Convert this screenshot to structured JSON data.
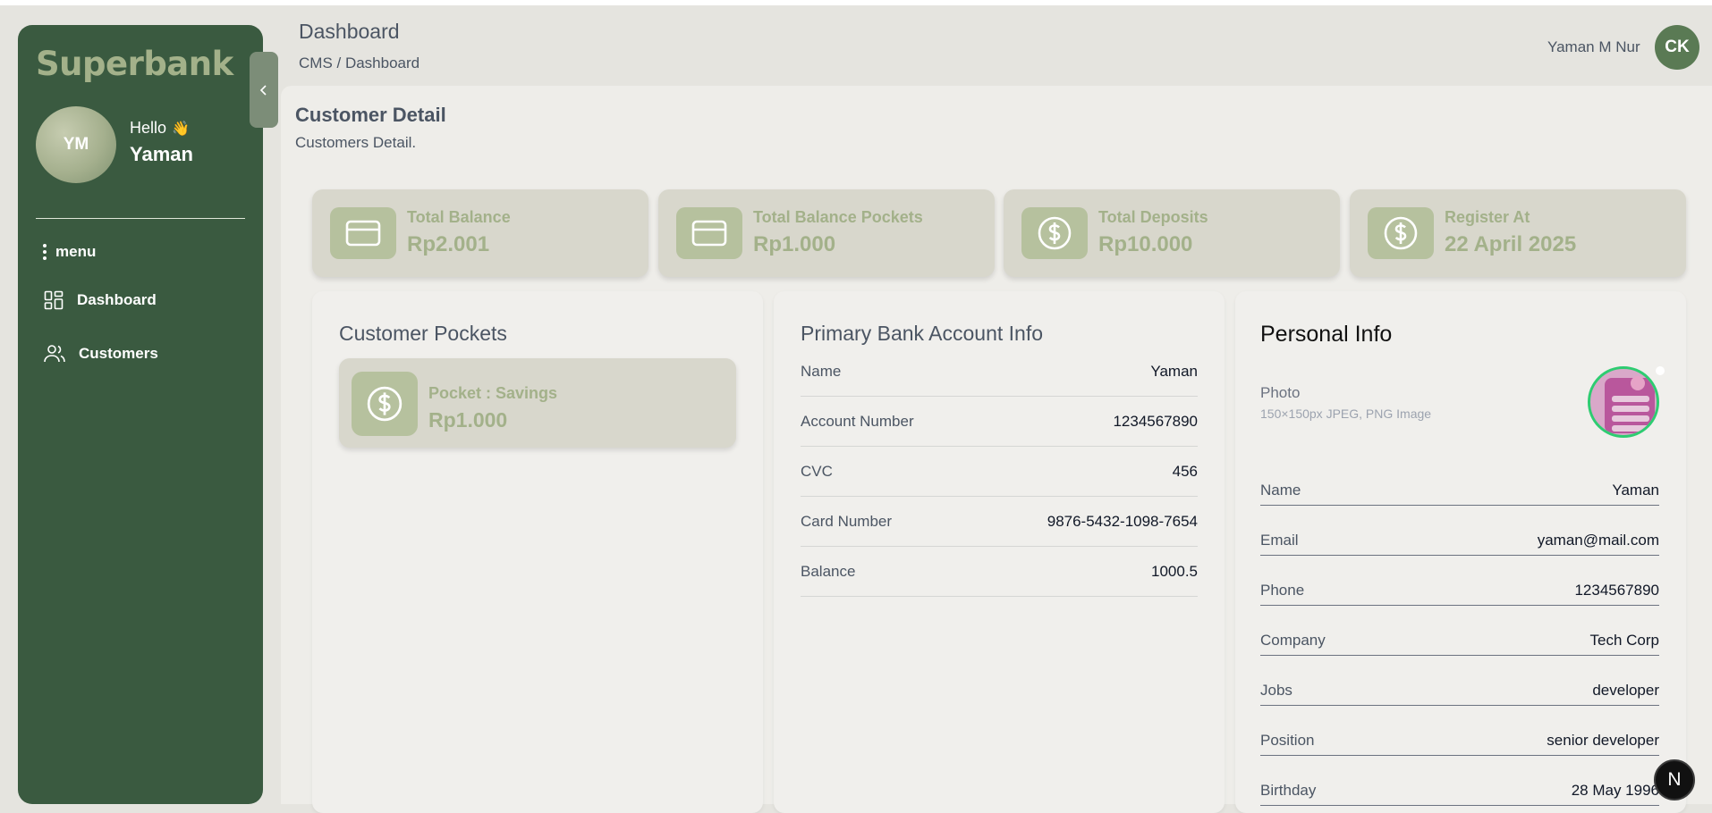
{
  "brand": "Superbank",
  "sidebar": {
    "avatar_initials": "YM",
    "greeting": "Hello",
    "greeting_emoji": "👋",
    "user_name": "Yaman",
    "menu_label": "menu",
    "items": [
      {
        "label": "Dashboard",
        "icon": "grid-icon"
      },
      {
        "label": "Customers",
        "icon": "users-icon"
      }
    ]
  },
  "header": {
    "title": "Dashboard",
    "breadcrumb": "CMS / Dashboard",
    "user_name": "Yaman M Nur",
    "avatar_initials": "CK"
  },
  "page": {
    "title": "Customer Detail",
    "subtitle": "Customers Detail."
  },
  "stats": [
    {
      "label": "Total Balance",
      "value": "Rp2.001",
      "icon": "card-icon"
    },
    {
      "label": "Total Balance Pockets",
      "value": "Rp1.000",
      "icon": "card-icon"
    },
    {
      "label": "Total Deposits",
      "value": "Rp10.000",
      "icon": "dollar-icon"
    },
    {
      "label": "Register At",
      "value": "22 April 2025",
      "icon": "dollar-icon"
    }
  ],
  "pockets": {
    "title": "Customer Pockets",
    "items": [
      {
        "label": "Pocket : Savings",
        "value": "Rp1.000",
        "icon": "dollar-icon"
      }
    ]
  },
  "bank_account": {
    "title": "Primary Bank Account Info",
    "rows": [
      {
        "key": "Name",
        "value": "Yaman"
      },
      {
        "key": "Account Number",
        "value": "1234567890"
      },
      {
        "key": "CVC",
        "value": "456"
      },
      {
        "key": "Card Number",
        "value": "9876-5432-1098-7654"
      },
      {
        "key": "Balance",
        "value": "1000.5"
      }
    ]
  },
  "personal_info": {
    "title": "Personal Info",
    "photo_label": "Photo",
    "photo_hint": "150×150px JPEG, PNG Image",
    "rows": [
      {
        "key": "Name",
        "value": "Yaman"
      },
      {
        "key": "Email",
        "value": "yaman@mail.com"
      },
      {
        "key": "Phone",
        "value": "1234567890"
      },
      {
        "key": "Company",
        "value": "Tech Corp"
      },
      {
        "key": "Jobs",
        "value": "developer"
      },
      {
        "key": "Position",
        "value": "senior developer"
      },
      {
        "key": "Birthday",
        "value": "28 May 1996"
      }
    ]
  },
  "badge": "N",
  "colors": {
    "sidebar": "#3a5a40",
    "accent": "#a3b18a",
    "card": "#d8d7cc",
    "icon_box": "#b6c19e",
    "photo_ring": "#2ecc71"
  }
}
